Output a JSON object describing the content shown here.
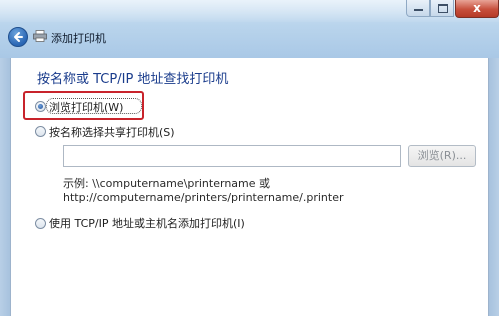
{
  "window": {
    "title": "添加打印机",
    "close_label": "x"
  },
  "page": {
    "heading": "按名称或 TCP/IP 地址查找打印机"
  },
  "options": [
    {
      "label": "浏览打印机(W)",
      "checked": true
    },
    {
      "label": "按名称选择共享打印机(S)",
      "checked": false
    },
    {
      "label": "使用 TCP/IP 地址或主机名添加打印机(I)",
      "checked": false
    }
  ],
  "share": {
    "input_value": "",
    "browse_label": "浏览(R)..."
  },
  "example": {
    "line1": "示例: \\\\computername\\printername 或",
    "line2": "http://computername/printers/printername/.printer"
  },
  "colors": {
    "heading": "#1a3c8c",
    "highlight": "#c8232b",
    "titlebar": "#b9d4ec"
  },
  "icons": [
    "back-arrow-icon",
    "printer-icon",
    "close-icon",
    "minimize-icon",
    "maximize-icon"
  ]
}
